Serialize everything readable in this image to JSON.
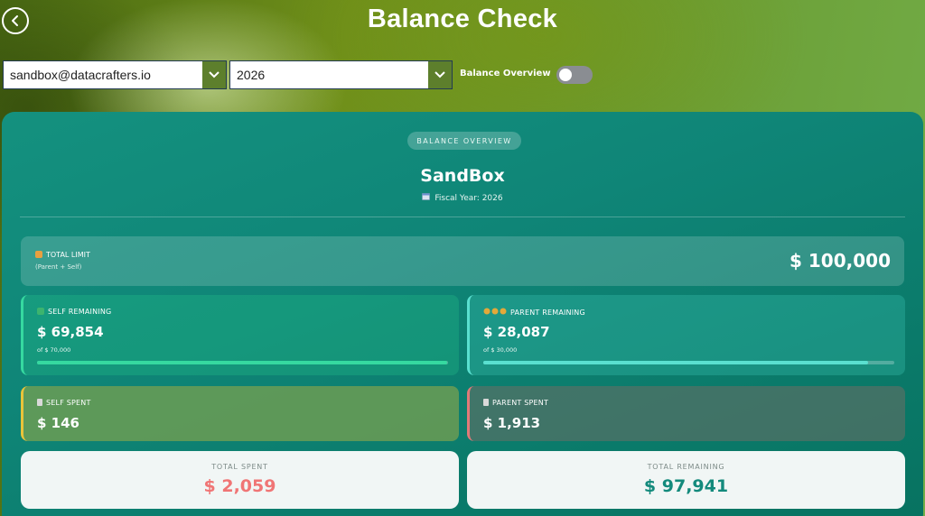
{
  "header": {
    "title": "Balance Check"
  },
  "filters": {
    "account_value": "sandbox@datacrafters.io",
    "year_value": "2026",
    "toggle_label": "Balance Overview",
    "toggle_on": false
  },
  "card": {
    "badge": "BALANCE OVERVIEW",
    "company": "SandBox",
    "fiscal_year": "Fiscal Year: 2026"
  },
  "total_limit": {
    "label": "TOTAL LIMIT",
    "sub": "(Parent + Self)",
    "value": "$ 100,000"
  },
  "self_remaining": {
    "label": "SELF REMAINING",
    "value": "$ 69,854",
    "of": "of $ 70,000",
    "progress_fraction": 0.998
  },
  "parent_remaining": {
    "label": "PARENT REMAINING",
    "value": "$ 28,087",
    "of": "of $ 30,000",
    "progress_fraction": 0.936
  },
  "self_spent": {
    "label": "SELF SPENT",
    "value": "$ 146"
  },
  "parent_spent": {
    "label": "PARENT SPENT",
    "value": "$ 1,913"
  },
  "summary": {
    "total_spent_label": "TOTAL SPENT",
    "total_spent_value": "$ 2,059",
    "total_remaining_label": "TOTAL REMAINING",
    "total_remaining_value": "$ 97,941"
  },
  "colors": {
    "spent_value": "#f07575",
    "remaining_value": "#138a7c",
    "self_bar": "#36d9a0",
    "parent_bar": "#5ae0d0"
  },
  "icons": {
    "back": "chevron-left-icon",
    "dropdown": "chevron-down-icon",
    "calendar": "calendar-icon",
    "house": "house-icon",
    "check": "check-icon",
    "coins": "coins-icon",
    "receipt": "receipt-icon"
  }
}
